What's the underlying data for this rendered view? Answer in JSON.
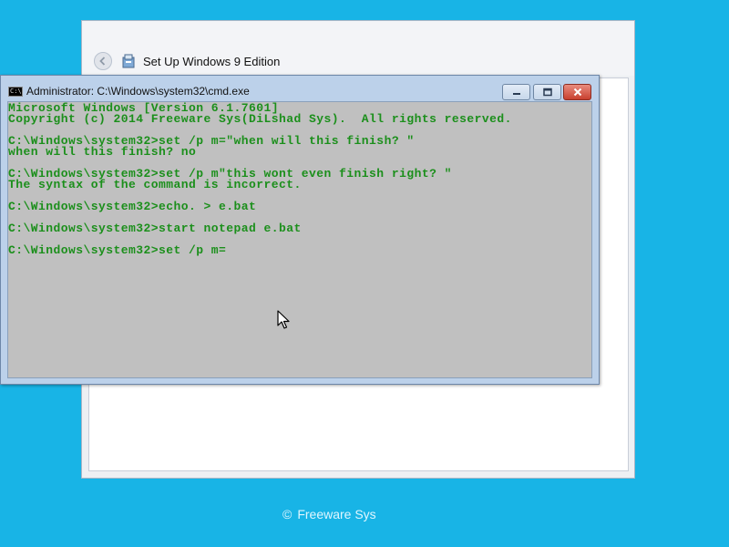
{
  "setup_window": {
    "title": "Set Up Windows 9 Edition"
  },
  "cmd_window": {
    "title": "Administrator: C:\\Windows\\system32\\cmd.exe",
    "icon_label": "C:\\",
    "lines": [
      "Microsoft Windows [Version 6.1.7601]",
      "Copyright (c) 2014 Freeware Sys(DiLshad Sys).  All rights reserved.",
      "",
      "C:\\Windows\\system32>set /p m=\"when will this finish? \"",
      "when will this finish? no",
      "",
      "C:\\Windows\\system32>set /p m\"this wont even finish right? \"",
      "The syntax of the command is incorrect.",
      "",
      "C:\\Windows\\system32>echo. > e.bat",
      "",
      "C:\\Windows\\system32>start notepad e.bat",
      "",
      "C:\\Windows\\system32>set /p m="
    ],
    "text_color": "#1b8f1b",
    "background_color": "#c0c0c0"
  },
  "footer": {
    "copyright_symbol": "©",
    "text": "Freeware Sys"
  },
  "icons": {
    "back": "back-arrow-icon",
    "setup": "setup-icon",
    "cmd": "cmd-icon",
    "minimize": "minimize-icon",
    "maximize": "maximize-icon",
    "close": "close-icon",
    "cursor": "mouse-cursor-icon"
  },
  "colors": {
    "desktop": "#18b4e6",
    "close_button": "#c8402f"
  }
}
